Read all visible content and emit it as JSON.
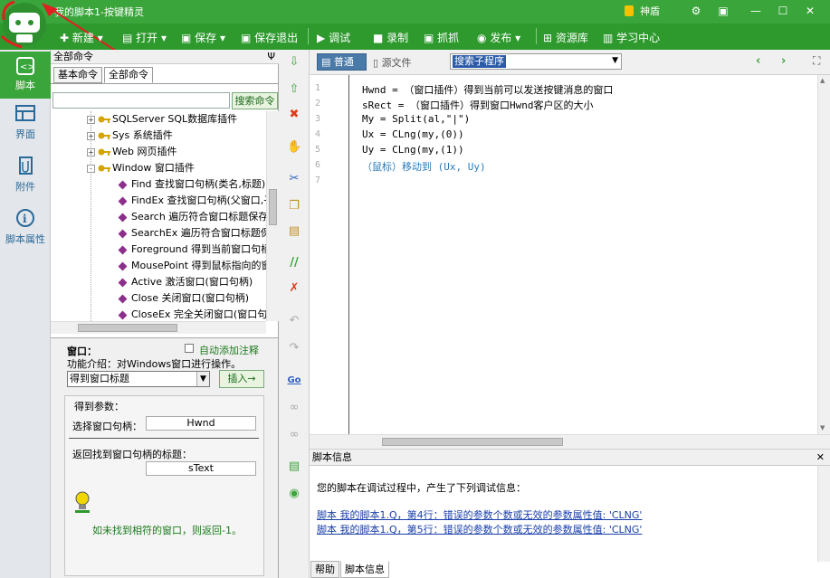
{
  "app": {
    "title": "我的脚本1-按键精灵",
    "shield_label": "神盾",
    "accent": "#3aa53a"
  },
  "toolbar": {
    "new": "新建",
    "open": "打开",
    "save": "保存",
    "save_exit": "保存退出",
    "debug": "调试",
    "record": "录制",
    "capture": "抓抓",
    "publish": "发布",
    "resources": "资源库",
    "learn": "学习中心"
  },
  "leftnav": {
    "items": [
      {
        "label": "脚本",
        "icon": "script-icon"
      },
      {
        "label": "界面",
        "icon": "ui-icon"
      },
      {
        "label": "附件",
        "icon": "attachment-icon"
      },
      {
        "label": "脚本属性",
        "icon": "info-icon"
      }
    ]
  },
  "commands": {
    "header": "全部命令",
    "pin": "Ψ",
    "tabs": [
      "基本命令",
      "全部命令"
    ],
    "search_button": "搜索命令",
    "search_value": "",
    "tree": [
      {
        "text": "SQLServer SQL数据库插件",
        "level": 1,
        "expander": "+"
      },
      {
        "text": "Sys 系统插件",
        "level": 1,
        "expander": "+"
      },
      {
        "text": "Web 网页插件",
        "level": 1,
        "expander": "+"
      },
      {
        "text": "Window 窗口插件",
        "level": 1,
        "expander": "-"
      },
      {
        "text": "Find 查找窗口句柄(类名,标题)[",
        "level": 2
      },
      {
        "text": "FindEx 查找窗口句柄(父窗口,子",
        "level": 2
      },
      {
        "text": "Search 遍历符合窗口标题保存",
        "level": 2
      },
      {
        "text": "SearchEx 遍历符合窗口标题保",
        "level": 2
      },
      {
        "text": "Foreground 得到当前窗口句柄",
        "level": 2
      },
      {
        "text": "MousePoint 得到鼠标指向的窗",
        "level": 2
      },
      {
        "text": "Active 激活窗口(窗口句柄)",
        "level": 2
      },
      {
        "text": "Close 关闭窗口(窗口句柄)",
        "level": 2
      },
      {
        "text": "CloseEx 完全关闭窗口(窗口句",
        "level": 2
      }
    ]
  },
  "info": {
    "title": "窗口：",
    "auto_comment_label": "自动添加注释",
    "desc": "功能介绍：对Windows窗口进行操作。",
    "select_value": "得到窗口标题",
    "insert_button": "插入→",
    "params_title": "得到参数：",
    "param1_label": "选择窗口句柄：",
    "param1_value": "Hwnd",
    "param2_label": "返回找到窗口句柄的标题：",
    "param2_value": "sText",
    "note": "如未找到相符的窗口，则返回-1。"
  },
  "editor": {
    "tab_normal": "普通",
    "tab_source": "源文件",
    "search_sub": "搜索子程序",
    "line_numbers": [
      "1",
      "2",
      "3",
      "4",
      "5",
      "6",
      "7"
    ],
    "lines": [
      "Hwnd = （窗口插件）得到当前可以发送按键消息的窗口",
      "sRect = （窗口插件）得到窗口Hwnd客户区的大小",
      "My = Split(al,\"|\")",
      "Ux = CLng(my,(0))",
      "Uy = CLng(my,(1))",
      "（鼠标）移动到 (Ux, Uy)",
      ""
    ]
  },
  "bottom": {
    "header": "脚本信息",
    "message": "您的脚本在调试过程中，产生了下列调试信息：",
    "errors": [
      "脚本 我的脚本1.Q，第4行：错误的参数个数或无效的参数属性值: 'CLNG'",
      "脚本 我的脚本1.Q，第5行：错误的参数个数或无效的参数属性值: 'CLNG'"
    ],
    "tabs": [
      "帮助",
      "脚本信息"
    ]
  }
}
